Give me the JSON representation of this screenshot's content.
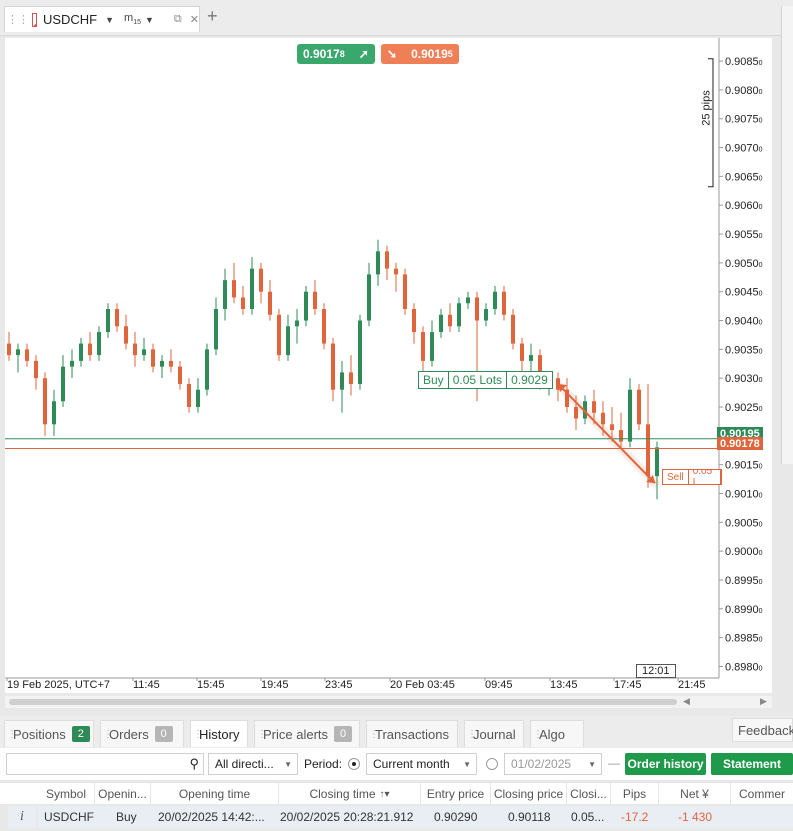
{
  "window": {
    "symbol": "USDCHF",
    "timeframe": "m",
    "timeframe_sub": "15"
  },
  "quotes": {
    "buy_price": "0.9017",
    "buy_sup": "8",
    "sell_price": "0.9019",
    "sell_sup": "5",
    "buy_color": "#3aa76d",
    "sell_color": "#ef7f56"
  },
  "chart_data": {
    "type": "candlestick",
    "y_ticks": [
      "0.9085",
      "0.9080",
      "0.9075",
      "0.9070",
      "0.9065",
      "0.9060",
      "0.9055",
      "0.9050",
      "0.9045",
      "0.9040",
      "0.9035",
      "0.9030",
      "0.9025",
      "0.9020",
      "0.9015",
      "0.9010",
      "0.9005",
      "0.9000",
      "0.8995",
      "0.8990",
      "0.8985",
      "0.8980"
    ],
    "y_tick_sub": "0",
    "ylim": [
      0.8978,
      0.9089
    ],
    "x_ticks": [
      "19 Feb 2025, UTC+7",
      "11:45",
      "15:45",
      "19:45",
      "23:45",
      "20 Feb 03:45",
      "09:45",
      "13:45",
      "17:45",
      "21:45"
    ],
    "pip_ruler": "25 pips",
    "bid_line": "0.90195",
    "ask_line": "0.90178",
    "bid_value": 0.90195,
    "ask_value": 0.90178,
    "cursor_time": "12:01",
    "open_trade": {
      "side": "Buy",
      "lots": "0.05 Lots",
      "price": "0.9029"
    },
    "close_trade": {
      "side": "Sell",
      "lots": "0.05 L"
    },
    "trade_entry": 0.9029,
    "trade_exit": 0.90118,
    "candles": [
      [
        0.9036,
        0.9038,
        0.9033,
        0.9034
      ],
      [
        0.9034,
        0.9036,
        0.9031,
        0.9035
      ],
      [
        0.9035,
        0.9036,
        0.9032,
        0.9033
      ],
      [
        0.9033,
        0.9034,
        0.9028,
        0.903
      ],
      [
        0.903,
        0.9031,
        0.902,
        0.9022
      ],
      [
        0.9022,
        0.9028,
        0.902,
        0.9026
      ],
      [
        0.9026,
        0.9034,
        0.9025,
        0.9032
      ],
      [
        0.9032,
        0.9035,
        0.903,
        0.9033
      ],
      [
        0.9033,
        0.9037,
        0.9032,
        0.9036
      ],
      [
        0.9036,
        0.9038,
        0.9033,
        0.9034
      ],
      [
        0.9034,
        0.9039,
        0.9033,
        0.9038
      ],
      [
        0.9038,
        0.9043,
        0.9037,
        0.9042
      ],
      [
        0.9042,
        0.9043,
        0.9038,
        0.9039
      ],
      [
        0.9039,
        0.9041,
        0.9035,
        0.9036
      ],
      [
        0.9036,
        0.9038,
        0.9032,
        0.9034
      ],
      [
        0.9034,
        0.9037,
        0.9033,
        0.9035
      ],
      [
        0.9035,
        0.9036,
        0.9031,
        0.9032
      ],
      [
        0.9032,
        0.9034,
        0.903,
        0.9033
      ],
      [
        0.9033,
        0.9035,
        0.9031,
        0.9032
      ],
      [
        0.9032,
        0.9033,
        0.9028,
        0.9029
      ],
      [
        0.9029,
        0.903,
        0.9024,
        0.9025
      ],
      [
        0.9025,
        0.903,
        0.9024,
        0.9028
      ],
      [
        0.9028,
        0.9036,
        0.9027,
        0.9035
      ],
      [
        0.9035,
        0.9044,
        0.9034,
        0.9042
      ],
      [
        0.9042,
        0.9049,
        0.904,
        0.9047
      ],
      [
        0.9047,
        0.905,
        0.9043,
        0.9044
      ],
      [
        0.9044,
        0.9046,
        0.9041,
        0.9042
      ],
      [
        0.9042,
        0.9051,
        0.9041,
        0.9049
      ],
      [
        0.9049,
        0.905,
        0.9043,
        0.9045
      ],
      [
        0.9045,
        0.9047,
        0.904,
        0.9041
      ],
      [
        0.9041,
        0.9042,
        0.9033,
        0.9034
      ],
      [
        0.9034,
        0.9041,
        0.9033,
        0.9039
      ],
      [
        0.9039,
        0.9042,
        0.9036,
        0.904
      ],
      [
        0.904,
        0.9046,
        0.9039,
        0.9045
      ],
      [
        0.9045,
        0.9047,
        0.9041,
        0.9042
      ],
      [
        0.9042,
        0.9043,
        0.9035,
        0.9036
      ],
      [
        0.9036,
        0.9037,
        0.9026,
        0.9028
      ],
      [
        0.9028,
        0.9033,
        0.9024,
        0.9031
      ],
      [
        0.9031,
        0.9034,
        0.9027,
        0.9029
      ],
      [
        0.9029,
        0.9041,
        0.9028,
        0.904
      ],
      [
        0.904,
        0.905,
        0.9039,
        0.9048
      ],
      [
        0.9048,
        0.9054,
        0.9046,
        0.9052
      ],
      [
        0.9052,
        0.9053,
        0.9047,
        0.9049
      ],
      [
        0.9049,
        0.905,
        0.9045,
        0.9048
      ],
      [
        0.9048,
        0.9049,
        0.9041,
        0.9042
      ],
      [
        0.9042,
        0.9043,
        0.9036,
        0.9038
      ],
      [
        0.9038,
        0.9039,
        0.9031,
        0.9033
      ],
      [
        0.9033,
        0.904,
        0.9032,
        0.9038
      ],
      [
        0.9038,
        0.9042,
        0.9037,
        0.9041
      ],
      [
        0.9041,
        0.9043,
        0.9038,
        0.9039
      ],
      [
        0.9039,
        0.9044,
        0.9038,
        0.9043
      ],
      [
        0.9043,
        0.9045,
        0.9042,
        0.9044
      ],
      [
        0.9044,
        0.9045,
        0.9026,
        0.904
      ],
      [
        0.904,
        0.9043,
        0.9039,
        0.9042
      ],
      [
        0.9042,
        0.9046,
        0.9041,
        0.9045
      ],
      [
        0.9045,
        0.9046,
        0.904,
        0.9041
      ],
      [
        0.9041,
        0.9042,
        0.9035,
        0.9036
      ],
      [
        0.9036,
        0.9037,
        0.9031,
        0.9033
      ],
      [
        0.9033,
        0.9036,
        0.903,
        0.9034
      ],
      [
        0.9034,
        0.9035,
        0.9028,
        0.9029
      ],
      [
        0.9029,
        0.9031,
        0.9027,
        0.903
      ],
      [
        0.903,
        0.9031,
        0.9026,
        0.9028
      ],
      [
        0.9028,
        0.903,
        0.9024,
        0.9025
      ],
      [
        0.9025,
        0.9027,
        0.9021,
        0.9023
      ],
      [
        0.9023,
        0.9027,
        0.9022,
        0.9026
      ],
      [
        0.9026,
        0.9028,
        0.9022,
        0.9024
      ],
      [
        0.9024,
        0.9026,
        0.902,
        0.9022
      ],
      [
        0.9022,
        0.9025,
        0.9019,
        0.9021
      ],
      [
        0.9021,
        0.9024,
        0.9018,
        0.9019
      ],
      [
        0.9019,
        0.903,
        0.9018,
        0.9028
      ],
      [
        0.9028,
        0.9029,
        0.9021,
        0.9022
      ],
      [
        0.9022,
        0.9029,
        0.9011,
        0.9013
      ],
      [
        0.9013,
        0.9019,
        0.9009,
        0.9018
      ]
    ],
    "up_color": "#2e8b57",
    "down_color": "#e0643c"
  },
  "panel": {
    "tabs": [
      {
        "label": "Positions",
        "count": "2"
      },
      {
        "label": "Orders",
        "count": "0"
      },
      {
        "label": "History"
      },
      {
        "label": "Price alerts",
        "count": "0"
      },
      {
        "label": "Transactions"
      },
      {
        "label": "Journal"
      },
      {
        "label": "Algo"
      }
    ],
    "feedback": "Feedback",
    "search_placeholder": "",
    "direction": "All directi...",
    "period_label": "Period:",
    "period_value": "Current month",
    "date_value": "01/02/2025",
    "dash": "—",
    "order_history": "Order history",
    "statement": "Statement",
    "columns": [
      "Symbol",
      "Openin...",
      "Opening time",
      "Closing time",
      "Entry price",
      "Closing price",
      "Closi...",
      "Pips",
      "Net ¥",
      "Commer"
    ],
    "sort_glyph": "↑▾",
    "info_glyph": "i",
    "row": [
      "USDCHF",
      "Buy",
      "20/02/2025 14:42:...",
      "20/02/2025 20:28:21.912",
      "0.90290",
      "0.90118",
      "0.05...",
      "-17.2",
      "-1 430",
      ""
    ]
  }
}
